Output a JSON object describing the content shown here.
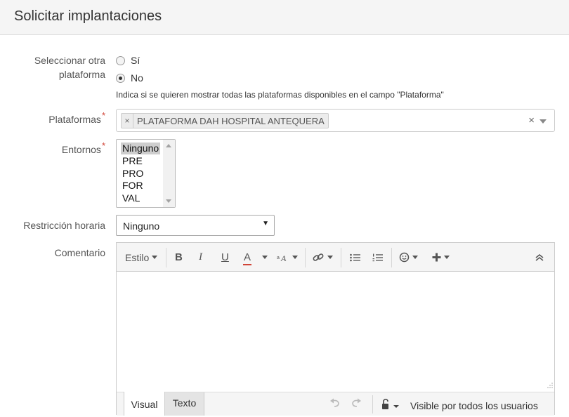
{
  "header": {
    "title": "Solicitar implantaciones"
  },
  "other_platform": {
    "label_line1": "Seleccionar otra",
    "label_line2": "plataforma",
    "options": [
      {
        "label": "Sí",
        "checked": false
      },
      {
        "label": "No",
        "checked": true
      }
    ],
    "help": "Indica si se quieren mostrar todas las plataformas disponibles en el campo \"Plataforma\""
  },
  "platforms": {
    "label": "Plataformas",
    "required_mark": "*",
    "chip_remove": "×",
    "selected": "PLATAFORMA DAH HOSPITAL ANTEQUERA",
    "clear": "×"
  },
  "environments": {
    "label": "Entornos",
    "required_mark": "*",
    "options": [
      "Ninguno",
      "PRE",
      "PRO",
      "FOR",
      "VAL"
    ],
    "selected_index": 0
  },
  "time_restriction": {
    "label": "Restricción horaria",
    "value": "Ninguno",
    "caret": "▼"
  },
  "comment": {
    "label": "Comentario",
    "toolbar": {
      "style_label": "Estilo",
      "bold": "B",
      "italic": "I",
      "underline": "U",
      "text_color": "A",
      "text_color_bar": "#d04437"
    },
    "tabs": {
      "visual": "Visual",
      "text": "Texto"
    },
    "visibility": "Visible por todos los usuarios"
  }
}
